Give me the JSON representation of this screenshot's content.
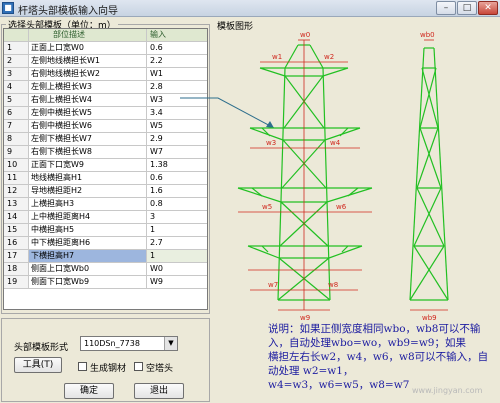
{
  "window": {
    "title": "杆塔头部模板输入向导",
    "minimize": "–",
    "maximize": "□",
    "close": "✕"
  },
  "left_group": {
    "label": "选择头部模板（单位：m）"
  },
  "grid": {
    "headers": {
      "num": "",
      "desc": "部位描述",
      "input": "输入"
    },
    "rows": [
      {
        "num": "1",
        "desc": "正面上口宽W0",
        "value": "0.6"
      },
      {
        "num": "2",
        "desc": "左侧地线横担长W1",
        "value": "2.2"
      },
      {
        "num": "3",
        "desc": "右侧地线横担长W2",
        "value": "W1"
      },
      {
        "num": "4",
        "desc": "左侧上横担长W3",
        "value": "2.8"
      },
      {
        "num": "5",
        "desc": "右侧上横担长W4",
        "value": "W3"
      },
      {
        "num": "6",
        "desc": "左侧中横担长W5",
        "value": "3.4"
      },
      {
        "num": "7",
        "desc": "右侧中横担长W6",
        "value": "W5"
      },
      {
        "num": "8",
        "desc": "左侧下横担长W7",
        "value": "2.9"
      },
      {
        "num": "9",
        "desc": "右侧下横担长W8",
        "value": "W7"
      },
      {
        "num": "10",
        "desc": "正面下口宽W9",
        "value": "1.38"
      },
      {
        "num": "11",
        "desc": "地线横担高H1",
        "value": "0.6"
      },
      {
        "num": "12",
        "desc": "导地横担距H2",
        "value": "1.6"
      },
      {
        "num": "13",
        "desc": "上横担高H3",
        "value": "0.8"
      },
      {
        "num": "14",
        "desc": "上中横担距离H4",
        "value": "3"
      },
      {
        "num": "15",
        "desc": "中横担高H5",
        "value": "1"
      },
      {
        "num": "16",
        "desc": "中下横担距离H6",
        "value": "2.7"
      },
      {
        "num": "17",
        "desc": "下横担高H7",
        "value": "1"
      },
      {
        "num": "18",
        "desc": "侧面上口宽Wb0",
        "value": "W0"
      },
      {
        "num": "19",
        "desc": "侧面下口宽Wb9",
        "value": "W9"
      }
    ]
  },
  "form": {
    "template_label": "头部模板形式",
    "template_value": "110DSn_7738",
    "tool_button": "工具(T)",
    "gen_steel_label": "生成钢材",
    "empty_head_label": "空塔头",
    "ok_button": "确定",
    "exit_button": "退出"
  },
  "drawing": {
    "label": "模板图形",
    "front_labels": {
      "top": "w0",
      "bottom": "w9",
      "w1": "w1",
      "w2": "w2",
      "w3": "w3",
      "w4": "w4",
      "w5": "w5",
      "w6": "w6",
      "w7": "w7",
      "w8": "w8"
    },
    "side_labels": {
      "top": "wb0",
      "bottom": "wb9"
    },
    "note_lines": [
      "说明：如果正侧宽度相同wbo，wb8可以不输",
      "入，自动处理wbo=wo，wb9=w9；如果",
      "横担左右长w2，w4，w6，w8可以不输入，自",
      "动处理  w2=w1，",
      "w4=w3，w6=w5，w8=w7"
    ]
  },
  "watermark": "www.jingyan.com",
  "colors": {
    "tower": "#22c022",
    "dimension": "#d0281e",
    "note": "#1c1ca0",
    "selected_row": "#9db6de"
  }
}
